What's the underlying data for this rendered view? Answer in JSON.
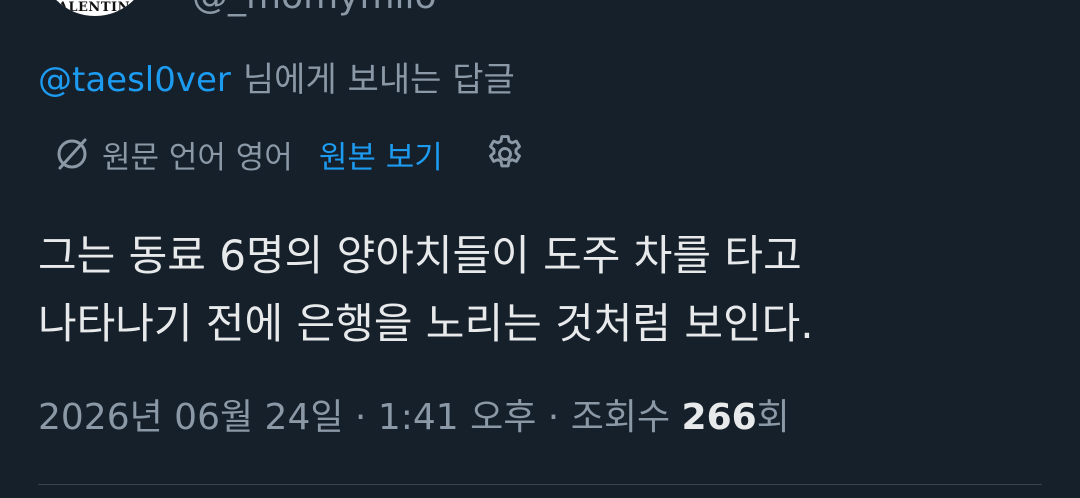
{
  "author": {
    "avatar_text": "VALENTINO",
    "handle_partial": "@_momymilo"
  },
  "reply": {
    "handle": "@taesl0ver",
    "suffix": "님에게 보내는 답글"
  },
  "translation": {
    "icon": "translate-icon",
    "info": "원문 언어 영어",
    "show_original": "원본 보기",
    "settings_icon": "gear-icon"
  },
  "tweet": {
    "lines": [
      "그는 동료 6명의 양아치들이 도주 차를 타고",
      "나타나기 전에 은행을 노리는 것처럼 보인다."
    ]
  },
  "meta": {
    "date": "2026년 06월 24일",
    "sep1": " · ",
    "time": "1:41 오후",
    "sep2": " · ",
    "views_label": "조회수 ",
    "views_count": "266",
    "views_unit": "회"
  },
  "colors": {
    "background": "#15202b",
    "link": "#1d9bf0",
    "muted": "#8b98a5",
    "text": "#e7e9ea"
  }
}
